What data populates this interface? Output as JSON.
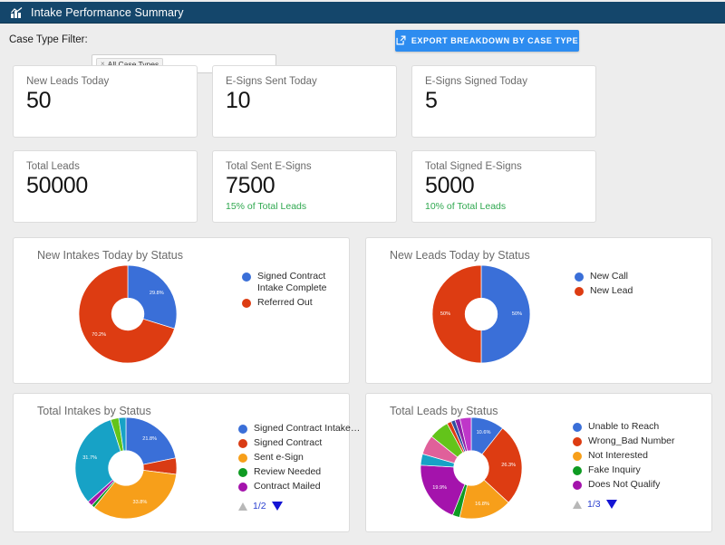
{
  "window": {
    "title": "Intake Performance Summary",
    "icon": "chart-icon",
    "header_bg": "#14466b"
  },
  "filter": {
    "label": "Case Type Filter:",
    "chip_label": "All Case Types",
    "chip_remove": "×"
  },
  "toolbar": {
    "export_label": "EXPORT BREAKDOWN BY CASE TYPE",
    "export_icon": "external-link-icon",
    "export_color": "#2d8cf0"
  },
  "kpis": {
    "row1": [
      {
        "title": "New Leads Today",
        "value": "50",
        "sub": ""
      },
      {
        "title": "E-Signs Sent Today",
        "value": "10",
        "sub": ""
      },
      {
        "title": "E-Signs Signed Today",
        "value": "5",
        "sub": ""
      }
    ],
    "row2": [
      {
        "title": "Total Leads",
        "value": "50000",
        "sub": ""
      },
      {
        "title": "Total Sent E-Signs",
        "value": "7500",
        "sub": "15% of Total Leads"
      },
      {
        "title": "Total Signed E-Signs",
        "value": "5000",
        "sub": "10% of Total Leads"
      }
    ]
  },
  "chart_data": [
    {
      "id": "new-intakes-today-by-status",
      "type": "pie",
      "title": "New Intakes Today by Status",
      "categories": [
        "Signed Contract Intake Complete",
        "Referred Out"
      ],
      "values": [
        29.8,
        70.2
      ],
      "labels": [
        "29.8%",
        "70.2%"
      ],
      "colors": [
        "#3a6fd8",
        "#dd3c12"
      ],
      "legend_position": "right",
      "pager": null
    },
    {
      "id": "new-leads-today-by-status",
      "type": "pie",
      "title": "New Leads Today by Status",
      "categories": [
        "New Call",
        "New Lead"
      ],
      "values": [
        50,
        50
      ],
      "labels": [
        "50%",
        "50%"
      ],
      "colors": [
        "#3a6fd8",
        "#dd3c12"
      ],
      "legend_position": "right",
      "pager": null
    },
    {
      "id": "total-intakes-by-status",
      "type": "pie",
      "title": "Total Intakes by Status",
      "categories": [
        "Signed Contract Intake…",
        "Signed Contract",
        "Sent e-Sign",
        "Review Needed",
        "Contract Mailed"
      ],
      "values": [
        21.8,
        5.2,
        33.8,
        1.0,
        1.6
      ],
      "labels": [
        "21.8%",
        "",
        "33.8%",
        "",
        ""
      ],
      "colors": [
        "#3a6fd8",
        "#d93b14",
        "#f79f1a",
        "#0f9b22",
        "#a413ac"
      ],
      "extra_slices": [
        {
          "value": 31.7,
          "label": "31.7%",
          "color": "#17a2c6"
        },
        {
          "value": 2.6,
          "label": "",
          "color": "#63c41a"
        },
        {
          "value": 2.3,
          "label": "",
          "color": "#17a2c6"
        }
      ],
      "legend_position": "right",
      "pager": {
        "current": "1/2",
        "up_enabled": false,
        "down_enabled": true
      }
    },
    {
      "id": "total-leads-by-status",
      "type": "pie",
      "title": "Total Leads by Status",
      "categories": [
        "Unable to Reach",
        "Wrong_Bad Number",
        "Not Interested",
        "Fake Inquiry",
        "Does Not Qualify"
      ],
      "values": [
        10.6,
        26.3,
        16.8,
        2.3,
        19.9
      ],
      "labels": [
        "10.6%",
        "26.3%",
        "16.8%",
        "",
        "19.9%"
      ],
      "colors": [
        "#3a6fd8",
        "#dd3c12",
        "#f79f1a",
        "#0f9b22",
        "#a413ac"
      ],
      "extra_slices": [
        {
          "value": 3.6,
          "label": "",
          "color": "#17a2c6"
        },
        {
          "value": 6.2,
          "label": "",
          "color": "#e0609a"
        },
        {
          "value": 6.4,
          "label": "",
          "color": "#63c41a"
        },
        {
          "value": 1.4,
          "label": "",
          "color": "#dd3c12"
        },
        {
          "value": 1.3,
          "label": "",
          "color": "#2f4f9e"
        },
        {
          "value": 1.6,
          "label": "",
          "color": "#8e1fa8"
        },
        {
          "value": 3.6,
          "label": "",
          "color": "#bf36c9"
        }
      ],
      "legend_position": "right",
      "pager": {
        "current": "1/3",
        "up_enabled": false,
        "down_enabled": true
      }
    }
  ]
}
